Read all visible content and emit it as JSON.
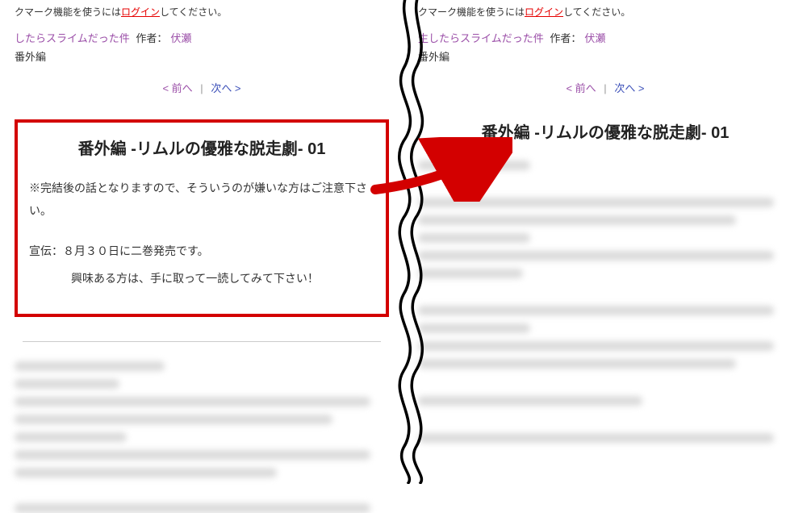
{
  "bookmark": {
    "prefix_partial": "クマーク機能を使うには",
    "login": "ログイン",
    "suffix": "してください。"
  },
  "series": {
    "title_partial_left": "したらスライムだった件",
    "title_partial_right": "生したらスライムだった件",
    "author_label": "作者：",
    "author": "伏瀬",
    "subtitle": "番外編"
  },
  "nav": {
    "prev": "< 前へ",
    "sep": "|",
    "next": "次へ >"
  },
  "chapter": {
    "title": "番外編 -リムルの優雅な脱走劇- 01"
  },
  "preface": {
    "line1": "※完結後の話となりますので、そういうのが嫌いな方はご注意下さい。",
    "line2": "宣伝：８月３０日に二巻発売です。",
    "line3": "興味ある方は、手に取って一読してみて下さい！"
  }
}
